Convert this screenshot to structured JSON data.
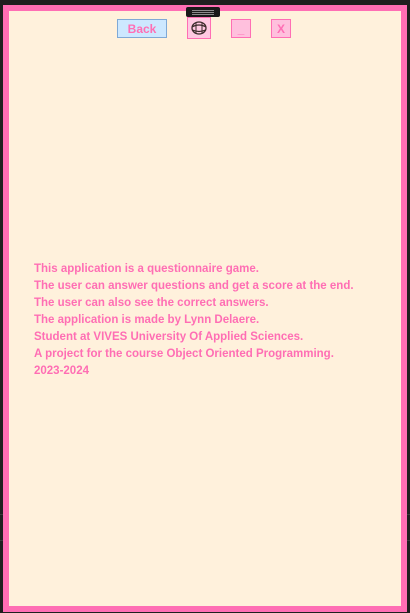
{
  "window": {
    "back_label": "Back",
    "minimize_label": "_",
    "close_label": "X",
    "icon": "globe-icon"
  },
  "about_lines": [
    "This application is a questionnaire game.",
    "The user can answer questions and get a score at the end.",
    "The user can also see the correct answers.",
    "The application is made by Lynn Delaere.",
    "Student at VIVES University Of Applied Sciences.",
    "A project for the course Object Oriented Programming.",
    "2023-2024"
  ],
  "colors": {
    "frame": "#ff6eb4",
    "background": "#fff1dc",
    "text": "#ff6eb4",
    "back_button": "#cde8ff"
  }
}
